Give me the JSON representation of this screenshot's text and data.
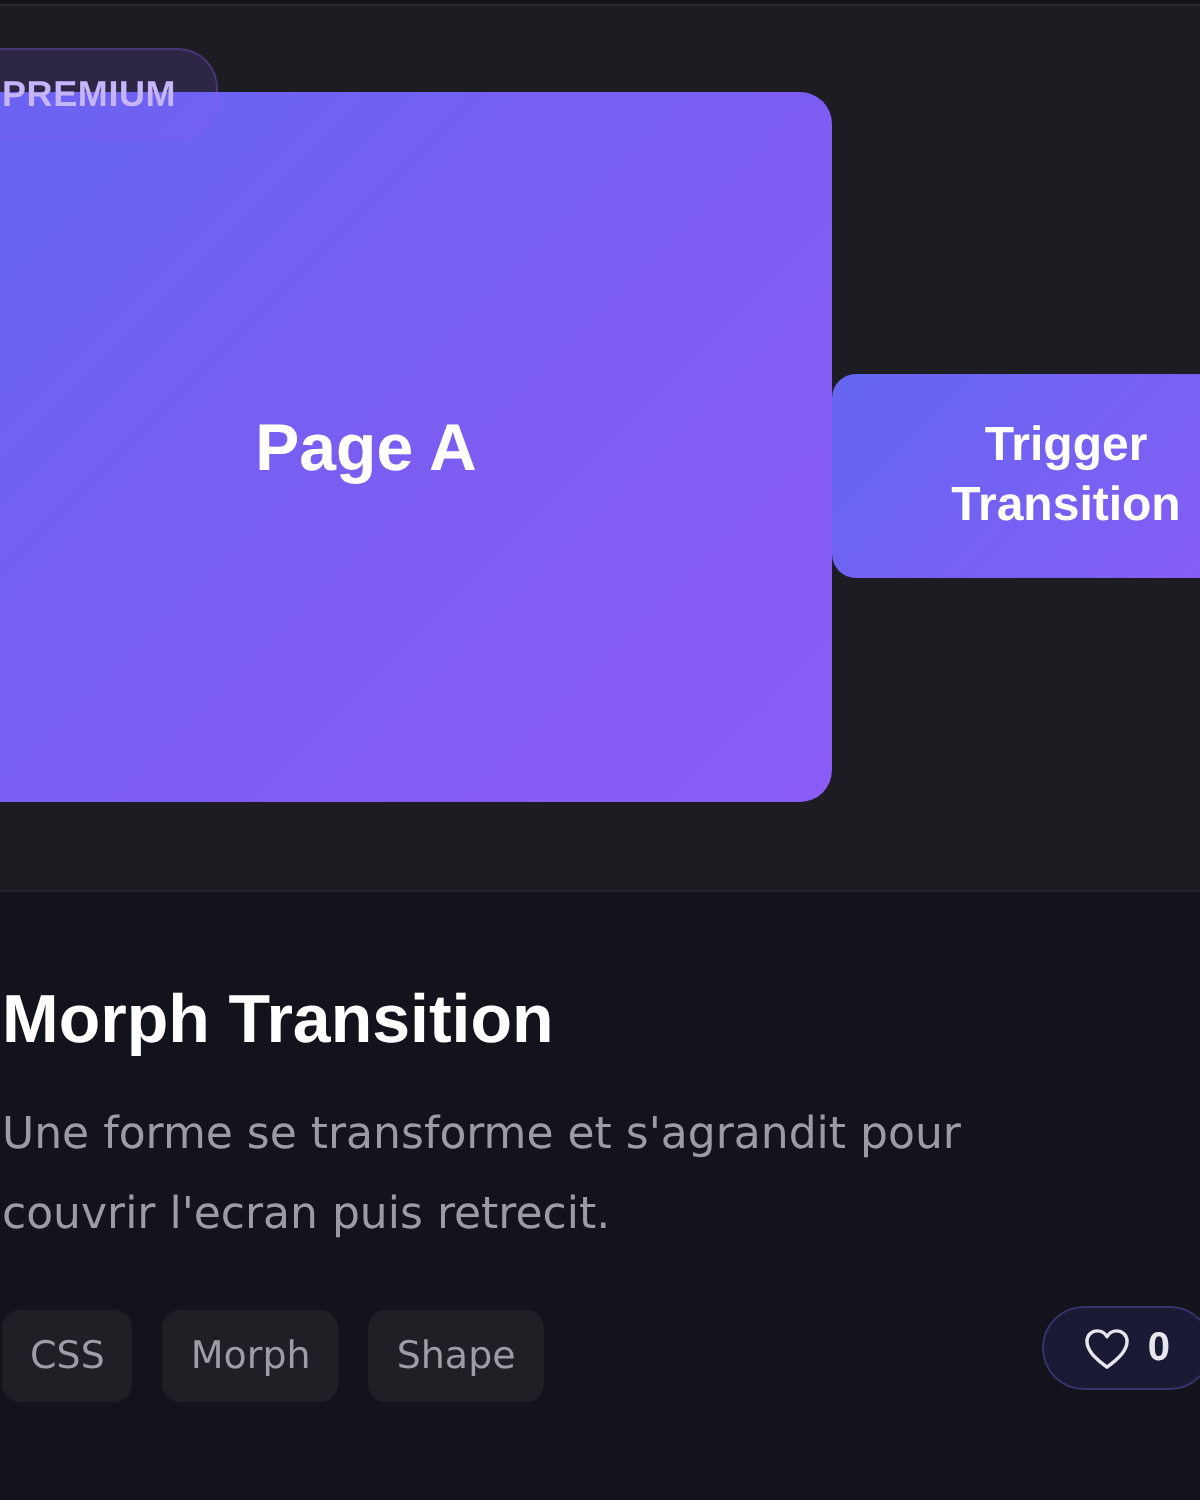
{
  "badge": {
    "label": "PREMIUM"
  },
  "preview": {
    "page": {
      "label": "Page A"
    },
    "trigger_button": {
      "label": "Trigger Transition"
    }
  },
  "title": "Morph Transition",
  "description": "Une forme se transforme et s'agrandit pour couvrir l'ecran puis retrecit.",
  "tags": [
    "CSS",
    "Morph",
    "Shape"
  ],
  "like_button": {
    "count": "0"
  }
}
